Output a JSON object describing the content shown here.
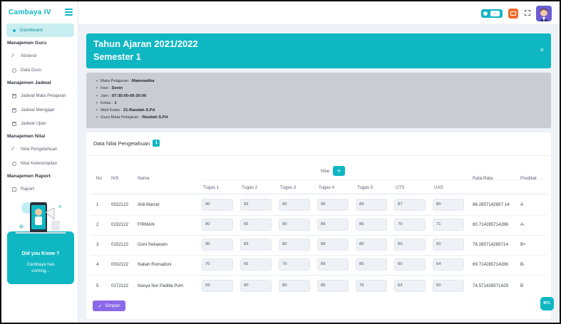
{
  "sidebar": {
    "brand": "Cambaya IV",
    "active": "Dashboard",
    "sections": [
      {
        "title": "Manajemen Guru",
        "items": [
          "Absensi",
          "Data Guru"
        ]
      },
      {
        "title": "Manajemen Jadwal",
        "items": [
          "Jadwal Mata Pelajaran",
          "Jadwal Mengajar",
          "Jadwal Ujian"
        ]
      },
      {
        "title": "Manajemen Nilai",
        "items": [
          "Nilai Pengetahuan",
          "Nilai Keterampilan"
        ]
      },
      {
        "title": "Manajemen Raport",
        "items": [
          "Raport"
        ]
      }
    ],
    "promo": {
      "title": "Did you Know ?",
      "text": "Cambaya has coming..."
    }
  },
  "topbar": {
    "toggle_icon": "toggle-icon",
    "mail_icon": "mail-icon",
    "expand_icon": "expand-icon",
    "avatar": "avatar"
  },
  "hero": {
    "title": "Tahun Ajaran 2021/2022",
    "subtitle": "Semester 1",
    "close": "×"
  },
  "info": [
    {
      "label": "Mata Pelajaran : ",
      "value": "Matematika"
    },
    {
      "label": "Hari : ",
      "value": "Senin"
    },
    {
      "label": "Jam : ",
      "value": "07:30:00-09:30:00"
    },
    {
      "label": "Kelas : ",
      "value": "1"
    },
    {
      "label": "Wali Kelas : ",
      "value": "21-Raodah S.Pd"
    },
    {
      "label": "Guru Mata Pelajaran : ",
      "value": "Raodah S.Pd"
    }
  ],
  "table": {
    "title": "Data Nilai Pengetahuan",
    "badge": "1",
    "headers": {
      "no": "No",
      "nis": "NIS",
      "nama": "Nama",
      "nilai": "Nilai",
      "nilai_add": "+",
      "rata": "Rata-Rata",
      "predikat": "Predikat"
    },
    "sub_headers": [
      "Tugas 1",
      "Tugas 2",
      "Tugas 3",
      "Tugas 4",
      "Tugas 5",
      "UTS",
      "UAS"
    ],
    "rows": [
      {
        "no": "1",
        "nis": "0022122",
        "nama": "Aldi Marcel",
        "scores": [
          "90",
          "92",
          "90",
          "90",
          "89",
          "87",
          "80"
        ],
        "rata": "86.2857142857 14",
        "predikat": "A"
      },
      {
        "no": "2",
        "nis": "0232122",
        "nama": "FIRMAN",
        "scores": [
          "90",
          "65",
          "90",
          "89",
          "80",
          "70",
          "71"
        ],
        "rata": "80.714285714286",
        "predikat": "A-"
      },
      {
        "no": "3",
        "nis": "0152122",
        "nama": "Goni Setiawam",
        "scores": [
          "90",
          "83",
          "80",
          "89",
          "80",
          "60",
          "60"
        ],
        "rata": "78.285714285714",
        "predikat": "B+"
      },
      {
        "no": "4",
        "nis": "0032122",
        "nama": "Naliah Romadoni",
        "scores": [
          "70",
          "65",
          "70",
          "89",
          "80",
          "60",
          "54"
        ],
        "rata": "69.714285714286",
        "predikat": "B-"
      },
      {
        "no": "5",
        "nis": "0172122",
        "nama": "Nasya Nur Padilla Putri",
        "scores": [
          "69",
          "90",
          "80",
          "85",
          "75",
          "63",
          "50"
        ],
        "rata": "74.571428571429",
        "predikat": "B"
      }
    ],
    "save": "Simpan"
  },
  "btl": "BTL"
}
